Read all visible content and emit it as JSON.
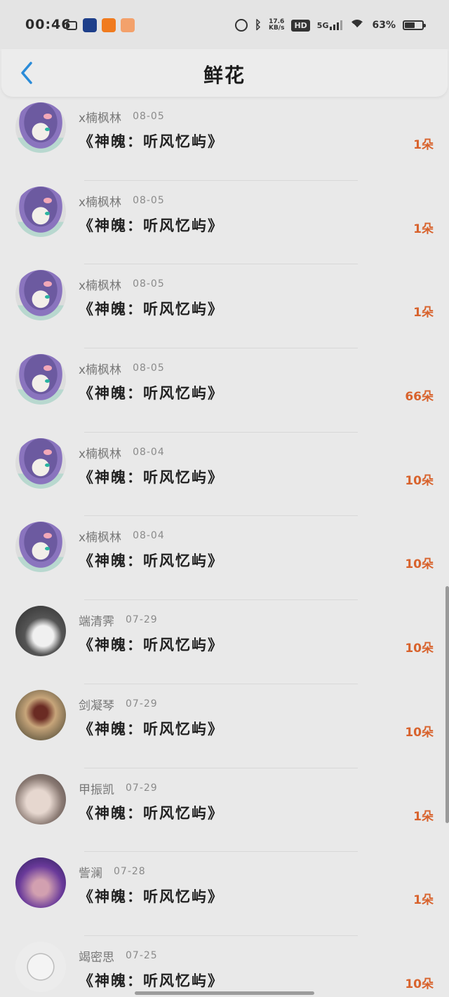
{
  "status_bar": {
    "time": "00:46",
    "speed_top": "17.6",
    "speed_bottom": "KB/s",
    "hd": "HD",
    "network": "5G",
    "battery": "63%"
  },
  "header": {
    "title": "鲜花",
    "back_icon": "chevron-left-icon"
  },
  "colors": {
    "accent_count": "#d8622c",
    "back_arrow": "#2a8bd8"
  },
  "rows": [
    {
      "user": "x楠枫林",
      "date": "08-05",
      "book": "《神魄：听风忆屿》",
      "count": "1朵",
      "avatar": "anime"
    },
    {
      "user": "x楠枫林",
      "date": "08-05",
      "book": "《神魄：听风忆屿》",
      "count": "1朵",
      "avatar": "anime"
    },
    {
      "user": "x楠枫林",
      "date": "08-05",
      "book": "《神魄：听风忆屿》",
      "count": "1朵",
      "avatar": "anime"
    },
    {
      "user": "x楠枫林",
      "date": "08-05",
      "book": "《神魄：听风忆屿》",
      "count": "66朵",
      "avatar": "anime"
    },
    {
      "user": "x楠枫林",
      "date": "08-04",
      "book": "《神魄：听风忆屿》",
      "count": "10朵",
      "avatar": "anime"
    },
    {
      "user": "x楠枫林",
      "date": "08-04",
      "book": "《神魄：听风忆屿》",
      "count": "10朵",
      "avatar": "anime"
    },
    {
      "user": "端清霁",
      "date": "07-29",
      "book": "《神魄：听风忆屿》",
      "count": "10朵",
      "avatar": "photo1"
    },
    {
      "user": "剑凝琴",
      "date": "07-29",
      "book": "《神魄：听风忆屿》",
      "count": "10朵",
      "avatar": "photo2"
    },
    {
      "user": "甲振凯",
      "date": "07-29",
      "book": "《神魄：听风忆屿》",
      "count": "1朵",
      "avatar": "photo3"
    },
    {
      "user": "訾澜",
      "date": "07-28",
      "book": "《神魄：听风忆屿》",
      "count": "1朵",
      "avatar": "photo4"
    },
    {
      "user": "竭密思",
      "date": "07-25",
      "book": "《神魄：听风忆屿》",
      "count": "10朵",
      "avatar": "sketch"
    }
  ]
}
